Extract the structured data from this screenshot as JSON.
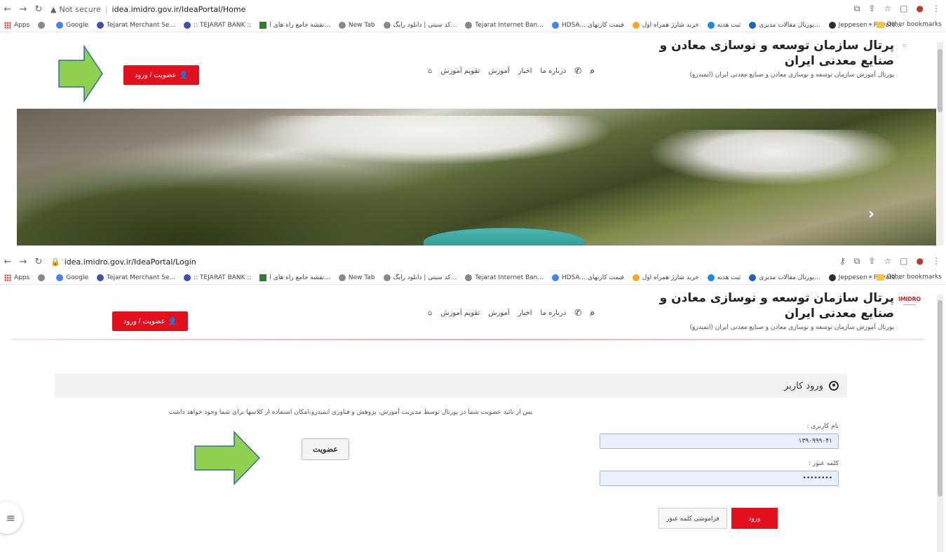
{
  "home_screen": {
    "browser": {
      "security_label": "Not secure",
      "url": "idea.imidro.gov.ir/IdeaPortal/Home"
    },
    "header": {
      "title": "پرتال سازمان توسعه و نوسازی معادن و صنایع معدنی ایران",
      "subtitle": "پورتال آموزش سازمان توسعه و نوسازی معادن و صنایع معدنی ایران (ایمیدرو)"
    },
    "nav": [
      "تقویم آموزش",
      "آموزش",
      "اخبار",
      "درباره ما"
    ],
    "auth_button_label": "عضویت / ورود"
  },
  "login_screen": {
    "browser": {
      "url": "idea.imidro.gov.ir/IdeaPortal/Login"
    },
    "logo_text": "IMIDRO",
    "header": {
      "title": "پرتال سازمان توسعه و نوسازی معادن و صنایع معدنی ایران",
      "subtitle": "پورتال آموزش سازمان توسعه و نوسازی معادن و صنایع معدنی ایران (ایمیدرو)"
    },
    "nav": [
      "تقویم آموزش",
      "آموزش",
      "اخبار",
      "درباره ما"
    ],
    "auth_button_label": "عضویت / ورود",
    "login_title": "ورود کاربر",
    "username_label": "نام کاربری :",
    "username_value": "۱۳۹۰۹۹۹۰۴۱",
    "password_label": "کلمه عبور :",
    "password_value": "••••••••",
    "login_button": "ورود",
    "forgot_button": "فراموشی کلمه عبور",
    "join_note": "پس از تائید عضویت شما در پورتال توسط مدیریت آموزش، پژوهش و فناوری ایمیدرو،امکان استفاده از کلاسها برای شما وجود خواهد داشت",
    "join_button": "عضویت"
  },
  "bookmarks": {
    "apps": "Apps",
    "items": [
      "Google",
      "Tejarat Merchant Se...",
      ":: TEJARAT BANK ::",
      "نقشه جامع راه های ا...",
      "New Tab",
      "کد سینی | دانلود رایگ...",
      "Tejarat Internet Ban...",
      "HDSA... قیمت کارتهای",
      "خرید شارژ همراه اول",
      "ثبت هدیه",
      "پورتال مقالات مدیری...",
      "Jeppesen - Private..."
    ],
    "other": "Other bookmarks"
  },
  "colors": {
    "accent_red": "#e3101e",
    "arrow_fill": "#8fd14f",
    "arrow_stroke": "#2f6f9f"
  },
  "icons": {
    "back": "arrow-left-icon",
    "forward": "arrow-right-icon",
    "reload": "reload-icon",
    "home_nav": "home-icon",
    "phone": "phone-icon",
    "search": "search-icon",
    "user_add": "user-plus-icon",
    "user_circle": "user-circle-icon",
    "menu": "hamburger-icon"
  }
}
